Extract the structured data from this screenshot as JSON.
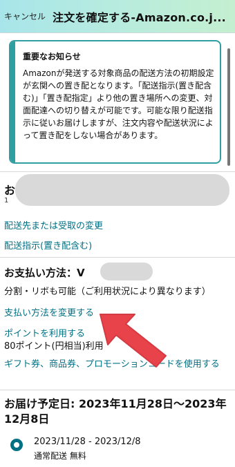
{
  "header": {
    "cancel_label": "キャンセル",
    "title": "注文を確定する-Amazon.co.j..."
  },
  "notice": {
    "title": "重要なお知らせ",
    "body": "Amazonが発送する対象商品の配送方法の初期設定が玄関への置き配となります。「配送指示(置き配含む)」「置き配指定」より他の置き場所への変更、対面配達への切り替えが可能です。可能な限り配送指示に従いお届けしますが、注文内容や配送状況によって置き配をしない場合があります。"
  },
  "address": {
    "heading_char": "お",
    "sub_char": "1",
    "change_link": "配送先または受取の変更",
    "instructions_link": "配送指示(置き配含む)"
  },
  "payment": {
    "heading": "お支払い方法：",
    "heading_suffix": "V",
    "installment_note": "分割・リボも可能（ご利用状況により異なります）",
    "change_link": "支払い方法を変更する",
    "points_link": "ポイントを利用する",
    "points_note": "80ポイント(円相当)利用",
    "gift_link": "ギフト券、商品券、プロモーションコードを使用する"
  },
  "delivery": {
    "heading": "お届け予定日: 2023年11月28日〜2023年12月8日",
    "option_date": "2023/11/28 - 2023/12/8",
    "option_shipping": "通常配送 無料"
  },
  "colors": {
    "accent_teal": "#007185",
    "notice_border": "#2e9ea0",
    "arrow_red": "#e8424a"
  }
}
